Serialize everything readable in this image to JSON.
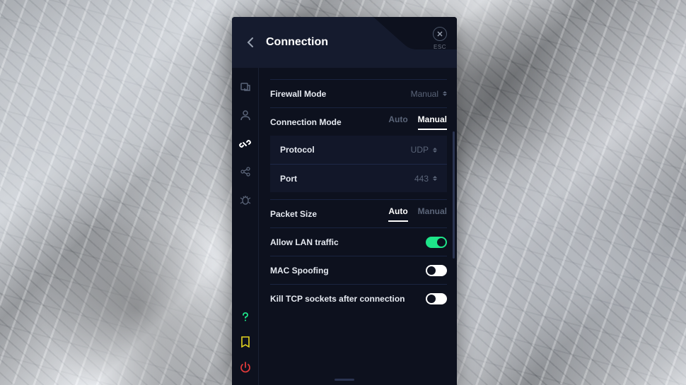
{
  "header": {
    "title": "Connection",
    "esc_label": "ESC"
  },
  "rows": {
    "firewall_mode": {
      "label": "Firewall Mode",
      "value": "Manual"
    },
    "connection_mode": {
      "label": "Connection Mode",
      "auto": "Auto",
      "manual": "Manual",
      "selected": "Manual"
    },
    "protocol": {
      "label": "Protocol",
      "value": "UDP"
    },
    "port": {
      "label": "Port",
      "value": "443"
    },
    "packet_size": {
      "label": "Packet Size",
      "auto": "Auto",
      "manual": "Manual",
      "selected": "Auto"
    },
    "allow_lan": {
      "label": "Allow LAN traffic",
      "on": true
    },
    "mac_spoof": {
      "label": "MAC Spoofing",
      "on": false
    },
    "kill_tcp": {
      "label": "Kill TCP sockets after connection",
      "on": false
    }
  },
  "colors": {
    "bg": "#0d111e",
    "accent": "#1ee58a",
    "muted": "#5a6478",
    "divider": "#1a2440"
  }
}
